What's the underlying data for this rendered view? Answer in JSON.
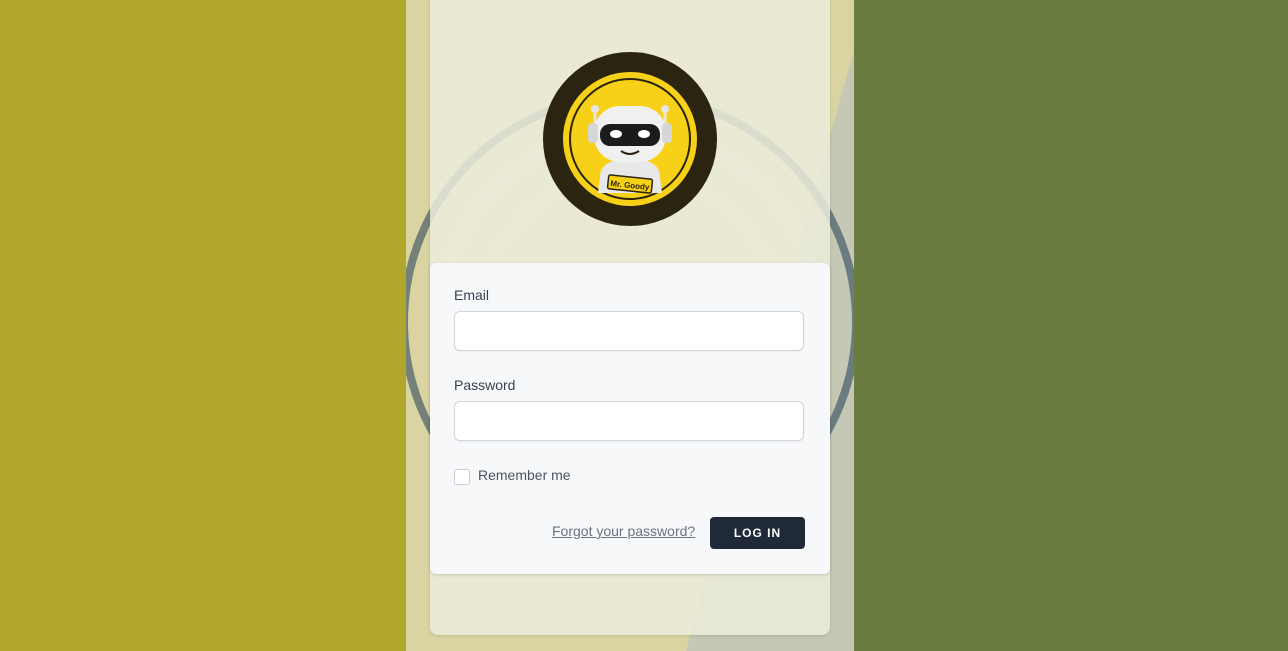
{
  "form": {
    "email_label": "Email",
    "email_value": "",
    "password_label": "Password",
    "password_value": "",
    "remember_label": "Remember me",
    "remember_checked": false,
    "forgot_link": "Forgot your password?",
    "login_button": "LOG IN"
  },
  "logo": {
    "badge_text": "Mr. Goody",
    "icon": "robot-mascot-icon"
  },
  "colors": {
    "left_background": "#b0a62c",
    "right_background": "#6b7c40",
    "button_background": "#1f2937",
    "logo_ring": "#2a2410",
    "logo_yellow": "#f7d117"
  }
}
